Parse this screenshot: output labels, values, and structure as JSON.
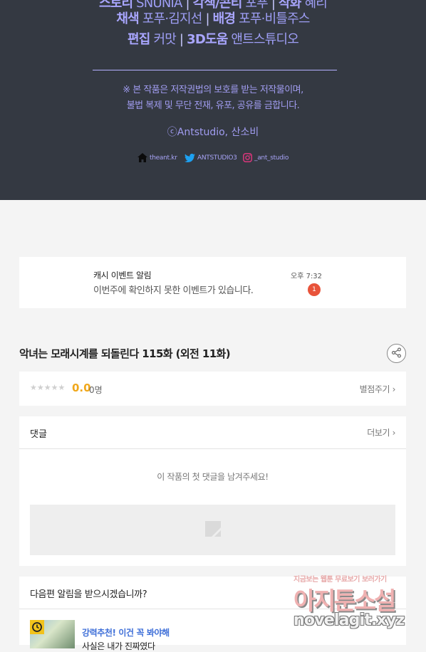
{
  "credits": {
    "line1": {
      "label_a": "스토리",
      "value_a": "SNUNIA",
      "label_b": "각색/콘티",
      "value_b": "포푸",
      "label_c": "작화",
      "value_c": "혜리"
    },
    "line2": {
      "label_a": "채색",
      "value_a": "포푸·김지선",
      "label_b": "배경",
      "value_b": "포푸·비틀주스"
    },
    "line3": {
      "label_a": "편집",
      "value_a": "커맛",
      "label_b": "3D도움",
      "value_b": "앤트스튜디오"
    },
    "separator": "|",
    "notice_line1": "※ 본 작품은 저작권법의 보호를 받는 저작물이며,",
    "notice_line2": "불법 복제 및 무단 전재, 유포, 공유를 금합니다.",
    "copyright": "ⓒAntstudio, 산소비",
    "socials": [
      {
        "icon": "home-icon",
        "text": "theant.kr"
      },
      {
        "icon": "twitter-icon",
        "text": "ANTSTUDIO3"
      },
      {
        "icon": "instagram-icon",
        "text": "_ant_studio"
      }
    ]
  },
  "notification": {
    "title": "캐시 이벤트 알림",
    "body": "이번주에 확인하지 못한 이벤트가 있습니다.",
    "time": "오후 7:32",
    "badge_count": "1"
  },
  "episode": {
    "title": "악녀는 모래시계를 되돌린다 115화 (외전 11화)"
  },
  "rating": {
    "stars": "★★★★★",
    "score": "0.0",
    "count": "0명",
    "rate_link": "별점주기 ›"
  },
  "comments": {
    "header": "댓글",
    "more_link": "더보기 ›",
    "empty_message": "이 작품의 첫 댓글을 남겨주세요!"
  },
  "next_episode": {
    "header": "다음편 알림을 받으시겠습니까?",
    "promo": "강력추천! 이건 꼭 봐야해",
    "subtitle": "사실은 내가 진짜였다"
  },
  "watermark": {
    "line1": "지금보는 웹툰 무료보기 보러가기",
    "line2": "아지툰소설",
    "line3": "novelagit.xyz"
  },
  "colors": {
    "banner_bg": "#343942",
    "banner_text": "#a9a6ff",
    "badge": "#e8533a",
    "score": "#f0a81c",
    "promo": "#3f6fd8"
  }
}
